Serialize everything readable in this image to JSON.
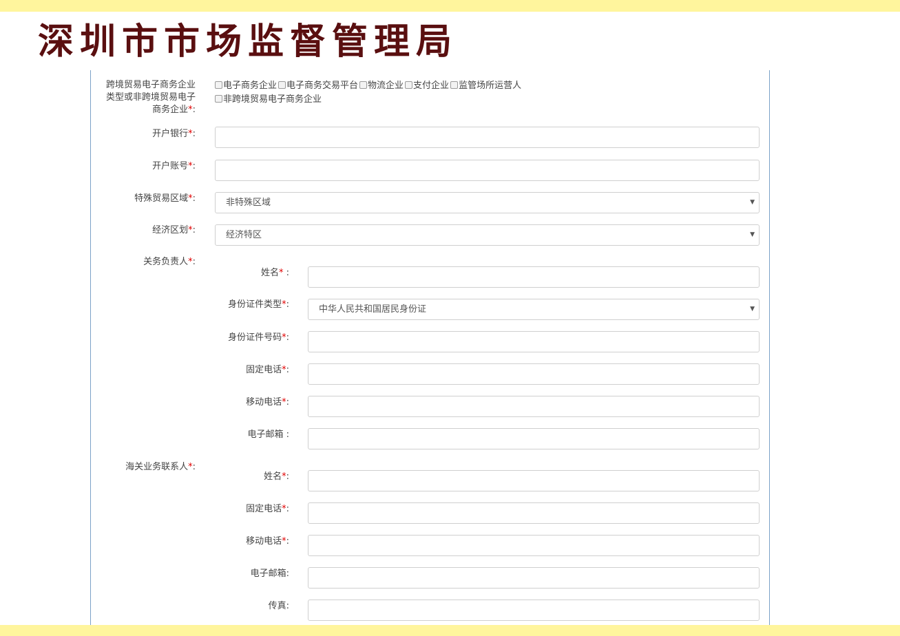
{
  "header": {
    "title": "深圳市市场监督管理局"
  },
  "form": {
    "enterprise_type": {
      "label_line1": "跨境贸易电子商务企业",
      "label_line2": "类型或非跨境贸易电子",
      "label_line3": "商务企业",
      "options": [
        "电子商务企业",
        "电子商务交易平台",
        "物流企业",
        "支付企业",
        "监管场所运营人",
        "非跨境贸易电子商务企业"
      ]
    },
    "bank": {
      "label": "开户银行",
      "value": ""
    },
    "account": {
      "label": "开户账号",
      "value": ""
    },
    "trade_zone": {
      "label": "特殊贸易区域",
      "value": "非特殊区域"
    },
    "economic_zone": {
      "label": "经济区划",
      "value": "经济特区"
    },
    "customs_officer": {
      "label": "关务负责人",
      "name_label": "姓名",
      "id_type_label": "身份证件类型",
      "id_type_value": "中华人民共和国居民身份证",
      "id_number_label": "身份证件号码",
      "phone_label": "固定电话",
      "mobile_label": "移动电话",
      "email_label": "电子邮箱"
    },
    "customs_contact": {
      "label": "海关业务联系人",
      "name_label": "姓名",
      "phone_label": "固定电话",
      "mobile_label": "移动电话",
      "email_label": "电子邮箱",
      "fax_label": "传真"
    }
  },
  "symbols": {
    "required": "*",
    "colon": ":",
    "colon_spaced": " :",
    "caret": "▼"
  },
  "colors": {
    "title": "#5a0f10",
    "band": "#fff59d",
    "required": "#e00000",
    "panel_border": "#7aa1c7"
  }
}
